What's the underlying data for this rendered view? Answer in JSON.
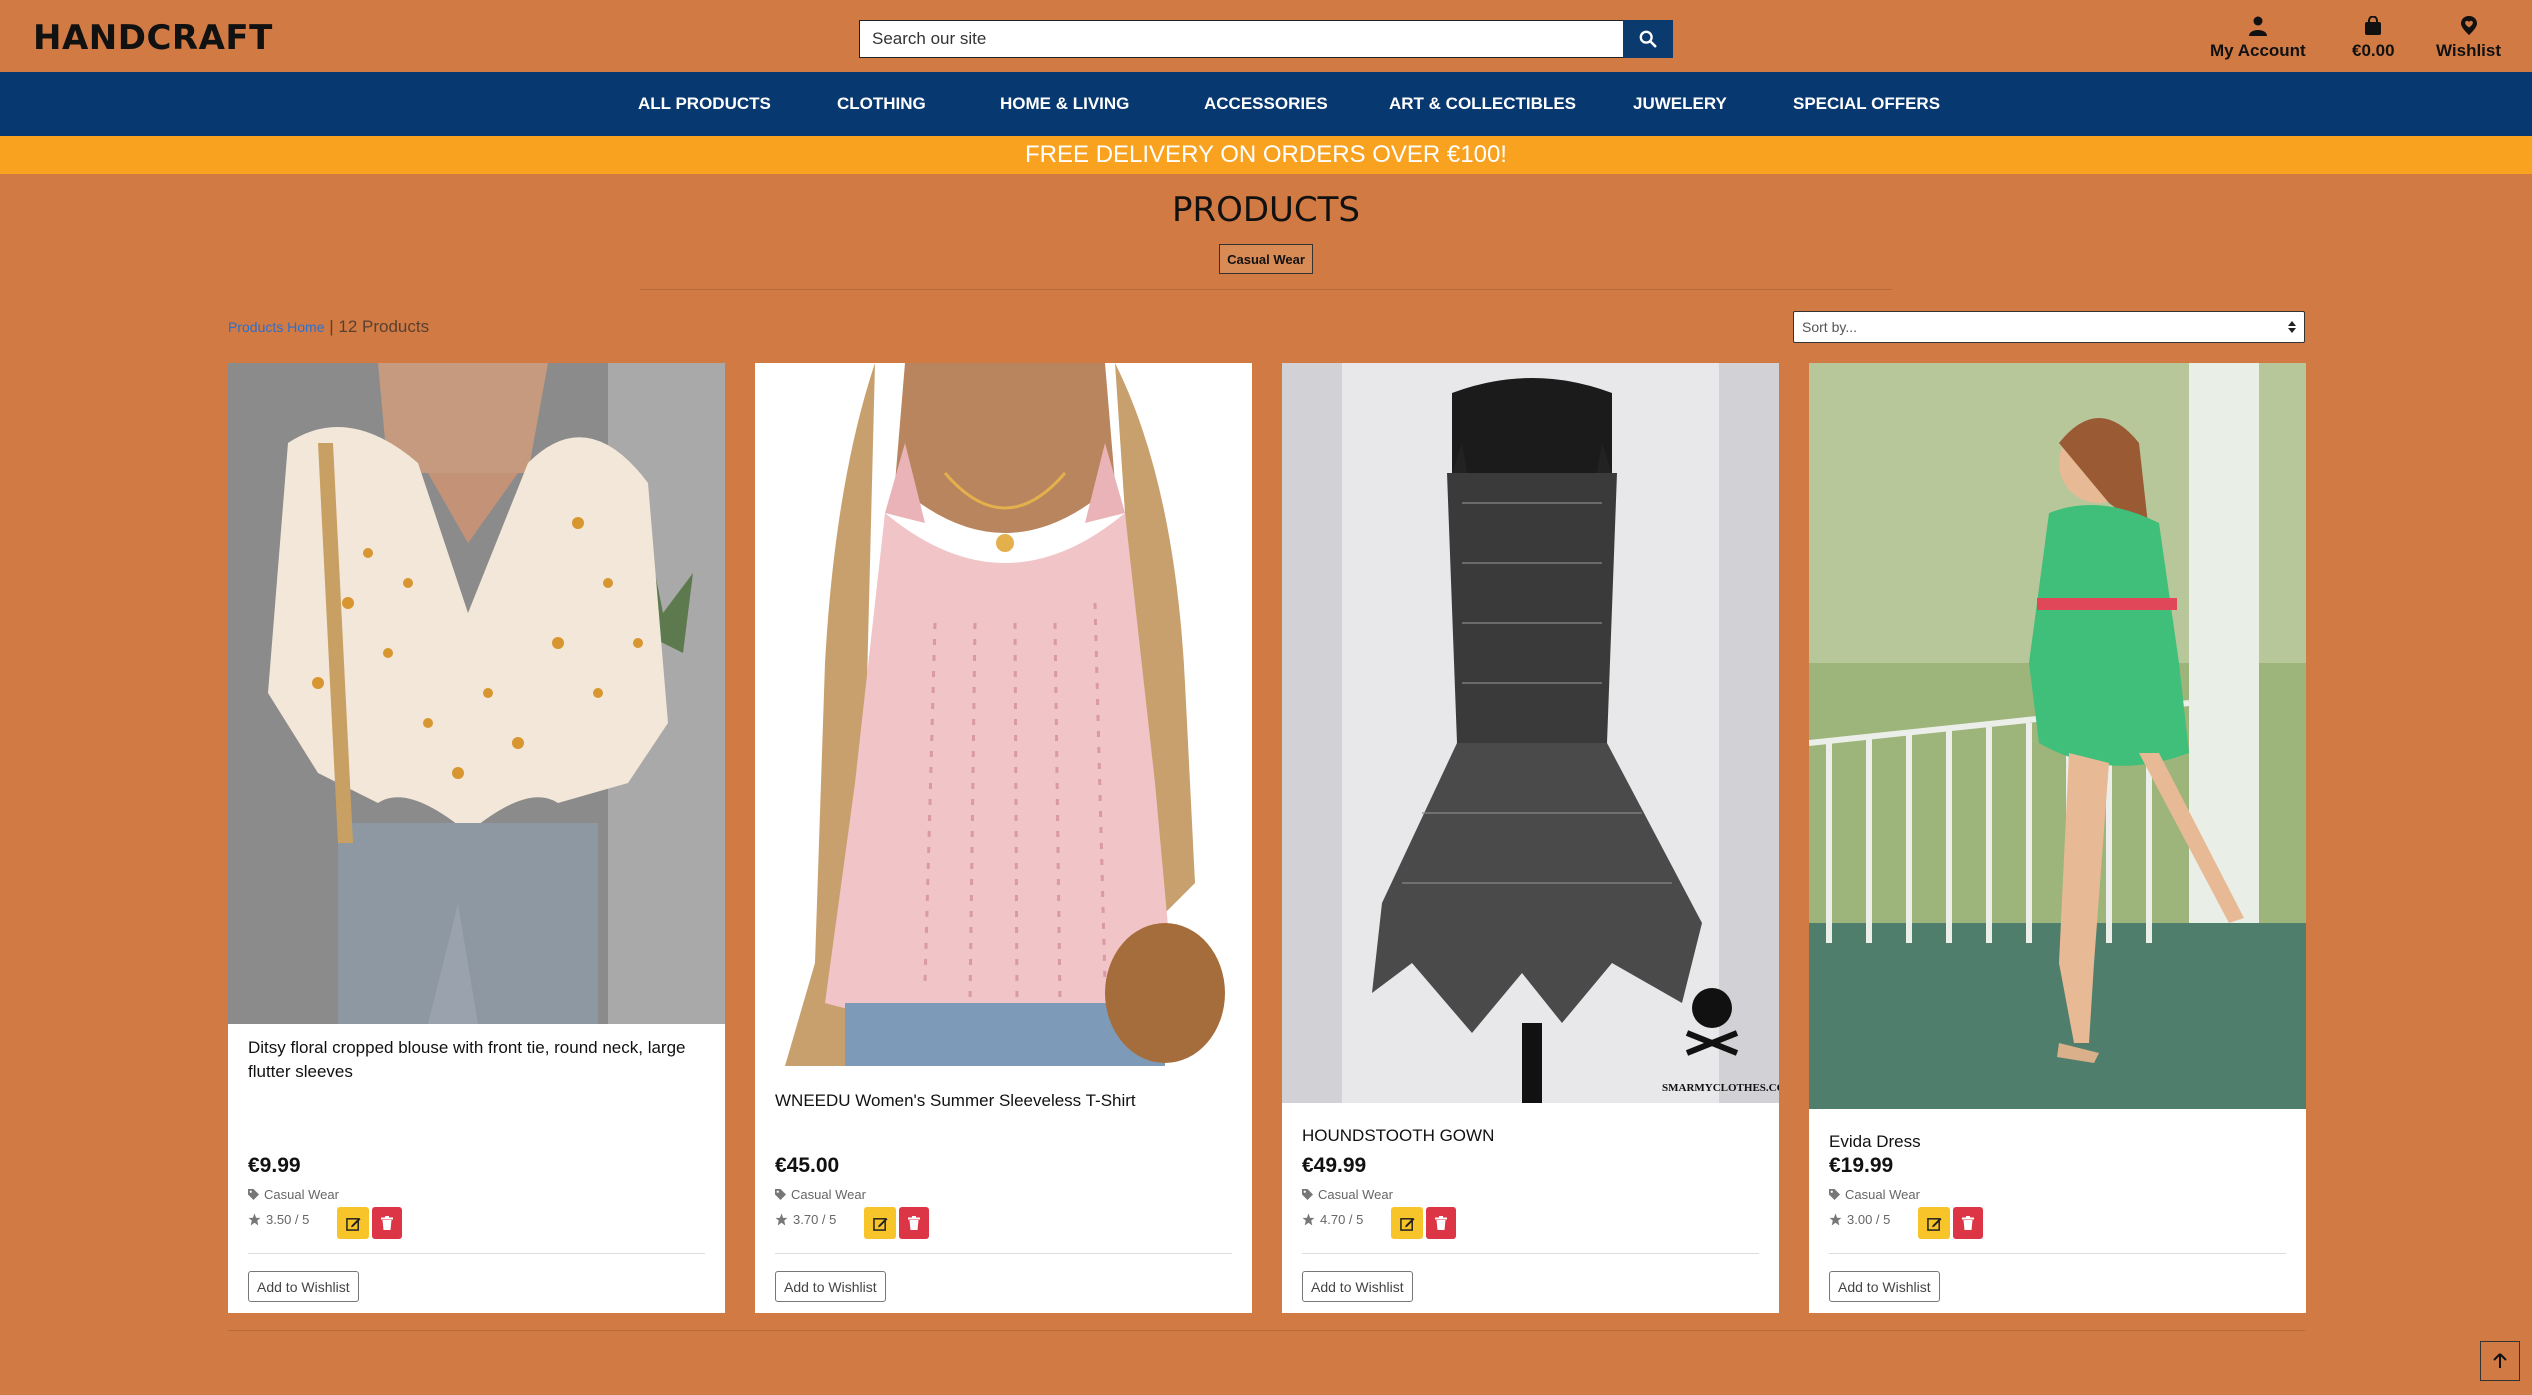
{
  "header": {
    "brand": "HANDCRAFT",
    "search_placeholder": "Search our site",
    "account_label": "My Account",
    "cart_label": "€0.00",
    "wishlist_label": "Wishlist"
  },
  "nav": {
    "items": [
      "ALL PRODUCTS",
      "CLOTHING",
      "HOME & LIVING",
      "ACCESSORIES",
      "ART & COLLECTIBLES",
      "JUWELERY",
      "SPECIAL OFFERS"
    ]
  },
  "promo": "FREE DELIVERY ON ORDERS OVER €100!",
  "page": {
    "title": "PRODUCTS",
    "filter_chip": "Casual Wear",
    "breadcrumb_link": "Products Home",
    "breadcrumb_sep": " | ",
    "count": "12 Products",
    "sort_placeholder": "Sort by..."
  },
  "products": [
    {
      "name": "Ditsy floral cropped blouse with front tie, round neck, large flutter sleeves",
      "price": "€9.99",
      "category": "Casual Wear",
      "rating": "3.50 / 5",
      "wishlist": "Add to Wishlist"
    },
    {
      "name": "WNEEDU Women's Summer Sleeveless T-Shirt",
      "price": "€45.00",
      "category": "Casual Wear",
      "rating": "3.70 / 5",
      "wishlist": "Add to Wishlist"
    },
    {
      "name": "HOUNDSTOOTH GOWN",
      "price": "€49.99",
      "category": "Casual Wear",
      "rating": "4.70 / 5",
      "wishlist": "Add to Wishlist"
    },
    {
      "name": "Evida Dress",
      "price": "€19.99",
      "category": "Casual Wear",
      "rating": "3.00 / 5",
      "wishlist": "Add to Wishlist"
    }
  ],
  "image_watermark": "SMARMYCLOTHES.COM",
  "colors": {
    "background": "#d17a44",
    "nav": "#07386f",
    "promo": "#f9a21f",
    "edit": "#f7c52a",
    "delete": "#dc3545"
  }
}
